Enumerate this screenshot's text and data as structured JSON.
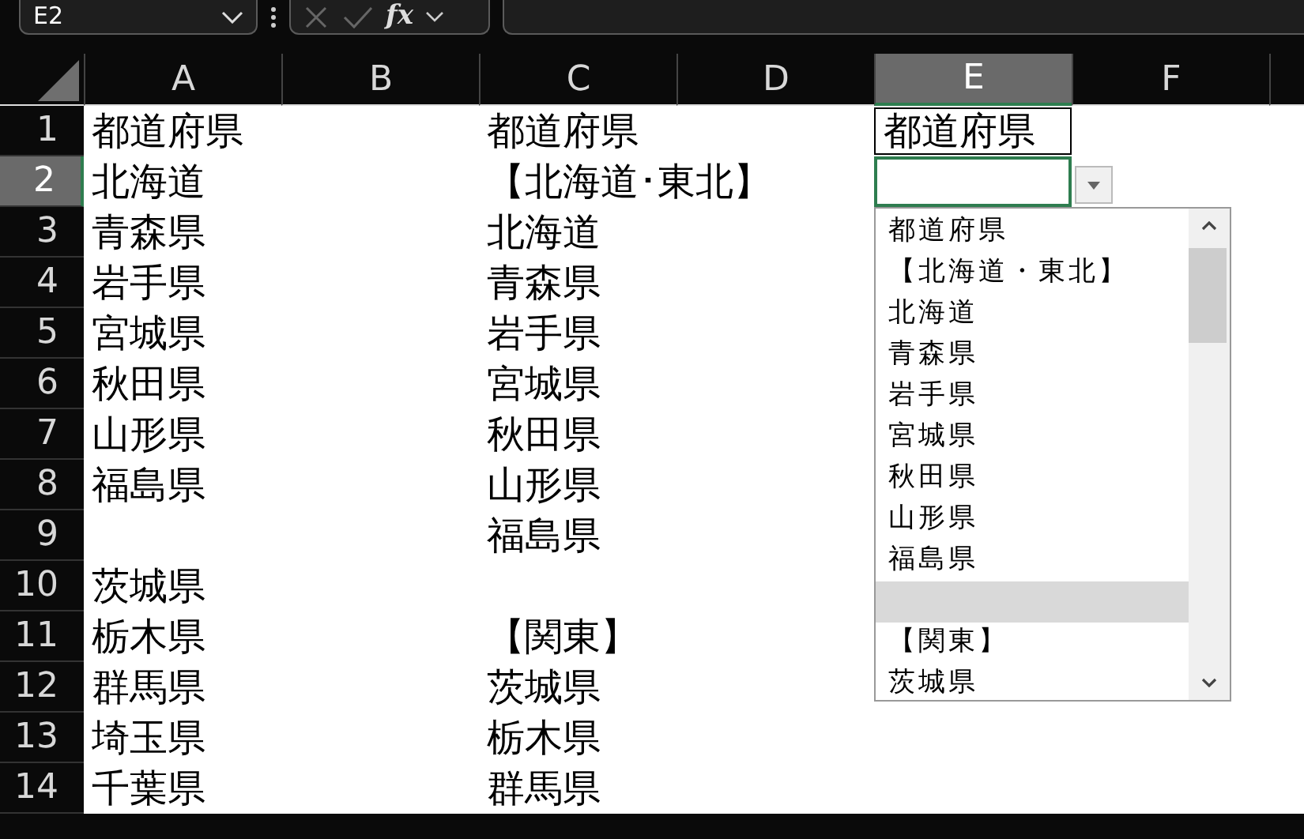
{
  "formula_bar": {
    "name_box": "E2",
    "function_label": "fx"
  },
  "columns": [
    {
      "label": "A",
      "selected": false
    },
    {
      "label": "B",
      "selected": false
    },
    {
      "label": "C",
      "selected": false
    },
    {
      "label": "D",
      "selected": false
    },
    {
      "label": "E",
      "selected": true
    },
    {
      "label": "F",
      "selected": false
    }
  ],
  "rows": [
    {
      "number": "1",
      "selected": false,
      "cells": {
        "A": {
          "text": "都道府県",
          "bordered": false
        },
        "C": {
          "text": "都道府県",
          "bordered": false
        },
        "E": {
          "text": "都道府県",
          "bordered": true
        }
      }
    },
    {
      "number": "2",
      "selected": true,
      "cells": {
        "A": {
          "text": "北海道",
          "bordered": false
        },
        "C": {
          "text": "【北海道･東北】",
          "bordered": false
        }
      }
    },
    {
      "number": "3",
      "selected": false,
      "cells": {
        "A": {
          "text": "青森県",
          "bordered": false
        },
        "C": {
          "text": "北海道",
          "bordered": false
        }
      }
    },
    {
      "number": "4",
      "selected": false,
      "cells": {
        "A": {
          "text": "岩手県",
          "bordered": false
        },
        "C": {
          "text": "青森県",
          "bordered": false
        }
      }
    },
    {
      "number": "5",
      "selected": false,
      "cells": {
        "A": {
          "text": "宮城県",
          "bordered": false
        },
        "C": {
          "text": "岩手県",
          "bordered": false
        }
      }
    },
    {
      "number": "6",
      "selected": false,
      "cells": {
        "A": {
          "text": "秋田県",
          "bordered": false
        },
        "C": {
          "text": "宮城県",
          "bordered": false
        }
      }
    },
    {
      "number": "7",
      "selected": false,
      "cells": {
        "A": {
          "text": "山形県",
          "bordered": false
        },
        "C": {
          "text": "秋田県",
          "bordered": false
        }
      }
    },
    {
      "number": "8",
      "selected": false,
      "cells": {
        "A": {
          "text": "福島県",
          "bordered": false
        },
        "C": {
          "text": "山形県",
          "bordered": false
        }
      }
    },
    {
      "number": "9",
      "selected": false,
      "cells": {
        "C": {
          "text": "福島県",
          "bordered": false
        }
      }
    },
    {
      "number": "10",
      "selected": false,
      "cells": {
        "A": {
          "text": "茨城県",
          "bordered": false
        }
      }
    },
    {
      "number": "11",
      "selected": false,
      "cells": {
        "A": {
          "text": "栃木県",
          "bordered": false
        },
        "C": {
          "text": "【関東】",
          "bordered": false
        }
      }
    },
    {
      "number": "12",
      "selected": false,
      "cells": {
        "A": {
          "text": "群馬県",
          "bordered": false
        },
        "C": {
          "text": "茨城県",
          "bordered": false
        }
      }
    },
    {
      "number": "13",
      "selected": false,
      "cells": {
        "A": {
          "text": "埼玉県",
          "bordered": false
        },
        "C": {
          "text": "栃木県",
          "bordered": false
        }
      }
    },
    {
      "number": "14",
      "selected": false,
      "cells": {
        "A": {
          "text": "千葉県",
          "bordered": false
        },
        "C": {
          "text": "群馬県",
          "bordered": false
        }
      }
    }
  ],
  "dropdown_list": {
    "items": [
      {
        "text": "都道府県",
        "selected": false
      },
      {
        "text": "【北海道・東北】",
        "selected": false
      },
      {
        "text": "北海道",
        "selected": false
      },
      {
        "text": "青森県",
        "selected": false
      },
      {
        "text": "岩手県",
        "selected": false
      },
      {
        "text": "宮城県",
        "selected": false
      },
      {
        "text": "秋田県",
        "selected": false
      },
      {
        "text": "山形県",
        "selected": false
      },
      {
        "text": "福島県",
        "selected": false
      },
      {
        "selected": true
      },
      {
        "text": "【関東】",
        "selected": false
      },
      {
        "text": "茨城県",
        "selected": false
      }
    ]
  }
}
